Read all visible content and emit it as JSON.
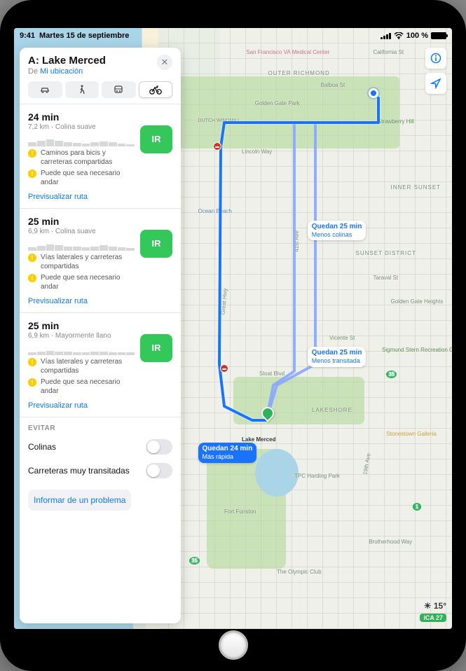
{
  "status": {
    "time": "9:41",
    "date": "Martes 15 de septiembre",
    "battery_pct": "100 %"
  },
  "directions": {
    "dest_prefix": "A:",
    "destination": "Lake Merced",
    "from_label": "De",
    "from_location": "Mi ubicación",
    "modes": {
      "drive": "car",
      "walk": "walk",
      "transit": "transit",
      "bike": "bike",
      "selected": "bike"
    }
  },
  "routes": [
    {
      "duration": "24 min",
      "distance": "7,2 km",
      "terrain": "Colina suave",
      "go_label": "IR",
      "advisories": [
        "Caminos para bicis y carreteras compartidas",
        "Puede que sea necesario andar"
      ],
      "preview": "Previsualizar ruta"
    },
    {
      "duration": "25 min",
      "distance": "6,9 km",
      "terrain": "Colina suave",
      "go_label": "IR",
      "advisories": [
        "Vías laterales y carreteras compartidas",
        "Puede que sea necesario andar"
      ],
      "preview": "Previsualizar ruta"
    },
    {
      "duration": "25 min",
      "distance": "6,9 km",
      "terrain": "Mayormente llano",
      "go_label": "IR",
      "advisories": [
        "Vías laterales y carreteras compartidas",
        "Puede que sea necesario andar"
      ],
      "preview": "Previsualizar ruta"
    }
  ],
  "avoid": {
    "header": "Evitar",
    "items": [
      {
        "label": "Colinas",
        "on": false
      },
      {
        "label": "Carreteras muy transitadas",
        "on": false
      }
    ]
  },
  "report_label": "Informar de un problema",
  "map": {
    "labels": {
      "ggpark": "Golden Gate Park",
      "vamed": "San Francisco VA Medical Center",
      "richmond": "OUTER RICHMOND",
      "inner": "INNER SUNSET",
      "sunset": "SUNSET DISTRICT",
      "lakeshore": "LAKESHORE",
      "oceanbeach": "Ocean Beach",
      "lakemerced": "Lake Merced",
      "fortfunston": "Fort Funston",
      "olympic": "The Olympic Club",
      "tpc": "TPC Harding Park",
      "stonestown": "Stonestown Galleria",
      "sternrec": "Sigmund Stern Recreation Grove",
      "strawberry": "Strawberry Hill",
      "ggheights": "Golden Gate Heights",
      "brotherhood": "Brotherhood Way",
      "lincoln": "Lincoln Way",
      "sloat": "Sloat Blvd",
      "vicente": "Vicente St",
      "taraval": "Taraval St",
      "balboa": "Balboa St",
      "california": "California St",
      "dutch": "DUTCH WINDMILL",
      "hwy1": "1",
      "hwy35": "35",
      "ave41": "41st Ave",
      "ave19": "19th Ave",
      "greathwy": "Great Hwy"
    },
    "callouts": {
      "primary_line1": "Quedan 24 min",
      "primary_line2": "Más rápida",
      "alt1_line1": "Quedan 25 min",
      "alt1_line2": "Menos colinas",
      "alt2_line1": "Quedan 25 min",
      "alt2_line2": "Menos transitada"
    }
  },
  "weather": {
    "temp": "15°",
    "aqi_label": "ICA 27"
  }
}
